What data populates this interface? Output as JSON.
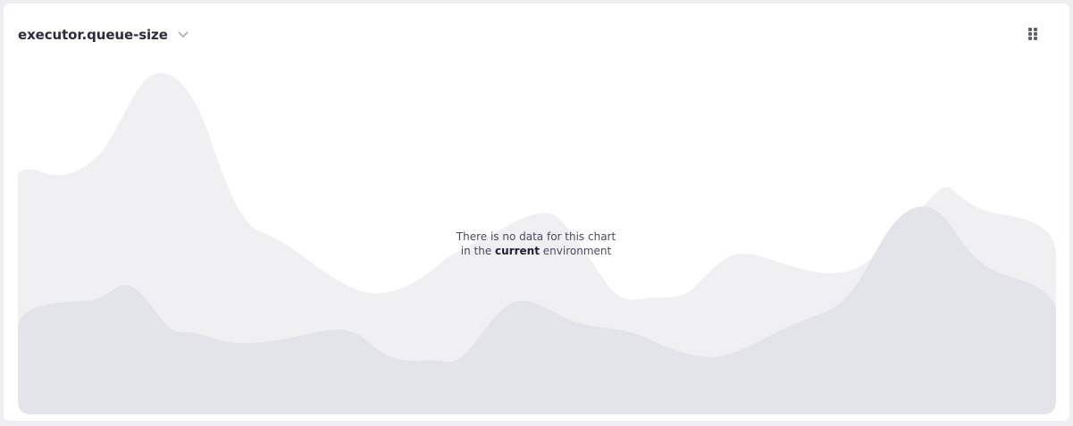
{
  "widget": {
    "title": "executor.queue-size",
    "chevron_icon": "chevron-down-icon",
    "menu_icon": "dots-grid-icon"
  },
  "empty_state": {
    "line1": "There is no data for this chart",
    "line2_prefix": "in the ",
    "line2_emphasis": "current",
    "line2_suffix": " environment"
  },
  "colors": {
    "card_background": "#ffffff",
    "page_background": "#eeeff3",
    "placeholder_back": "#f0f0f3",
    "placeholder_front": "#e3e4e9",
    "title": "#2b2d3c",
    "message": "#4a4c5d"
  }
}
